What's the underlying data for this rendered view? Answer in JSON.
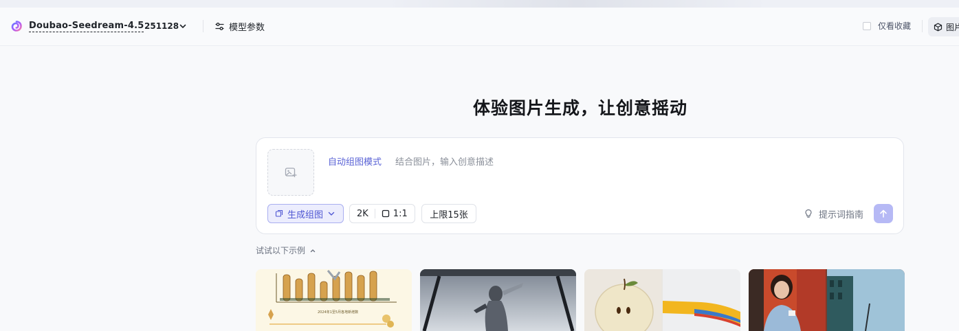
{
  "header": {
    "model_name": "Doubao-Seedream-4.5",
    "model_version": "251128",
    "params_label": "模型参数",
    "favorites_label": "仅看收藏",
    "right_tab_label": "图片"
  },
  "headline": "体验图片生成，让创意摇动",
  "prompt": {
    "mode_link": "自动组图模式",
    "placeholder": "结合图片，输入创意描述",
    "group_button": "生成组图",
    "resolution": "2K",
    "ratio": "1:1",
    "limit": "上限15张",
    "guide": "提示词指南"
  },
  "examples": {
    "label": "试试以下示例",
    "thumbnail_text": "2024年1至5月各地新增数"
  },
  "colors": {
    "accent": "#5a63d6",
    "send_button": "#b6b9f5",
    "chip_active_bg": "#ecedfd"
  }
}
